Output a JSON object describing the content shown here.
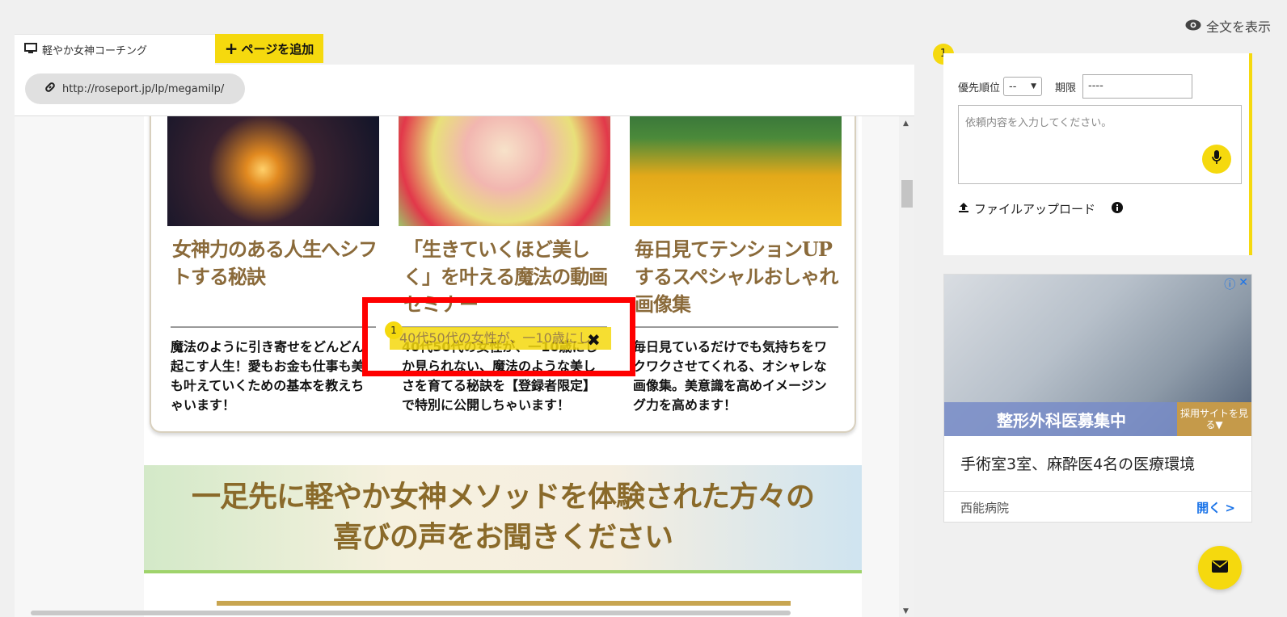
{
  "header": {
    "fulltext_label": "全文を表示",
    "fulltext_icon": "eye-icon"
  },
  "tabs": {
    "page_tab_label": "軽やか女神コーチング",
    "page_tab_icon": "monitor-icon",
    "add_page_label": "ページを追加"
  },
  "browser": {
    "url": "http://roseport.jp/lp/megamilp/"
  },
  "site": {
    "columns": [
      {
        "title": "女神力のある人生へシフトする秘訣",
        "body": "魔法のように引き寄せをどんどん起こす人生！愛もお金も仕事も美も叶えていくための基本を教えちゃいます！"
      },
      {
        "title": "「生きていくほど美しく」を叶える魔法の動画セミナー",
        "body": "40代50代の女性が、一10歳にしか見られない、魔法のような美しさを育てる秘訣を【登録者限定】で特別に公開しちゃいます！"
      },
      {
        "title": "毎日見てテンションUPするスペシャルおしゃれ画像集",
        "body": "毎日見ているだけでも気持ちをワクワクさせてくれる、オシャレな画像集。美意識を高めイメージング力を高めます！"
      }
    ],
    "testimonial_heading_line1": "一足先に軽やか女神メソッドを体験された方々の",
    "testimonial_heading_line2": "喜びの声をお聞きください"
  },
  "annotation": {
    "number": "1",
    "highlight_text": "40代50代の女性が、一10歳にし"
  },
  "request_form": {
    "badge": "1",
    "priority_label": "優先順位",
    "priority_value": "--",
    "deadline_label": "期限",
    "deadline_value": "----",
    "textarea_placeholder": "依頼内容を入力してください。",
    "upload_label": "ファイルアップロード"
  },
  "ad": {
    "banner_text": "整形外科医募集中",
    "banner_cta": "採用サイトを見る▼",
    "title": "手術室3室、麻酔医4名の医療環境",
    "source": "西能病院",
    "open_label": "開く"
  },
  "colors": {
    "accent": "#f5d90e",
    "annotation_border": "#ff0000",
    "heading_gold": "#8a6a3a"
  }
}
